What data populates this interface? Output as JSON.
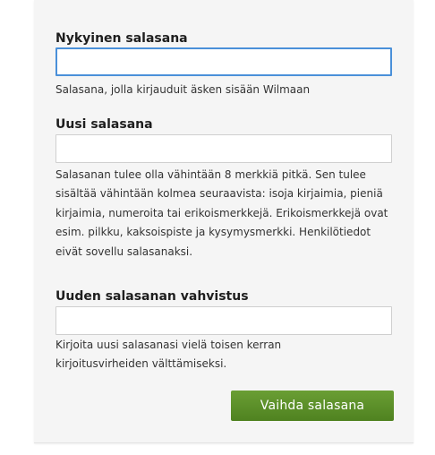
{
  "form": {
    "current_password": {
      "label": "Nykyinen salasana",
      "value": "",
      "help": "Salasana, jolla kirjauduit äsken sisään Wilmaan"
    },
    "new_password": {
      "label": "Uusi salasana",
      "value": "",
      "help": "Salasanan tulee olla vähintään 8 merkkiä pitkä. Sen tulee sisältää vähintään kolmea seuraavista: isoja kirjaimia, pieniä kirjaimia, numeroita tai erikoismerkkejä. Erikoismerkkejä ovat esim. pilkku, kaksoispiste ja kysymysmerkki. Henkilötiedot eivät sovellu salasanaksi."
    },
    "confirm_password": {
      "label": "Uuden salasanan vahvistus",
      "value": "",
      "help": "Kirjoita uusi salasanasi vielä toisen kerran kirjoitusvirheiden välttämiseksi."
    },
    "submit_label": "Vaihda salasana",
    "colors": {
      "focus_border": "#4a90d9",
      "submit_button": "#5b8f29"
    }
  }
}
